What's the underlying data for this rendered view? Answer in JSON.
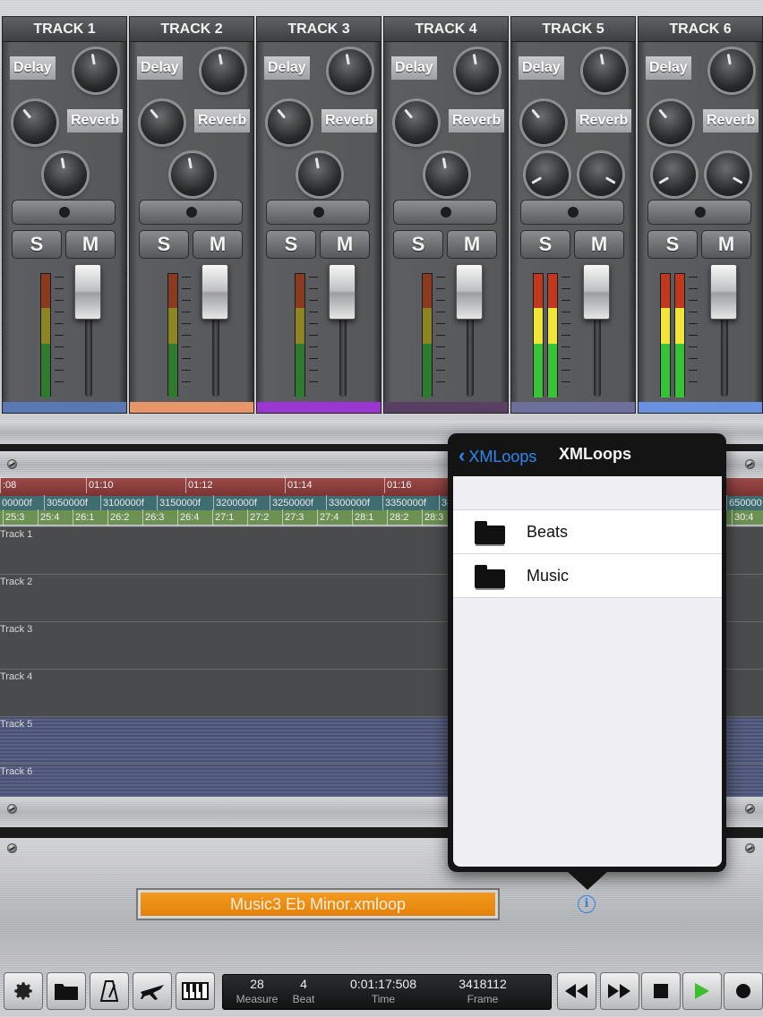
{
  "mixer": {
    "tracks": [
      {
        "title": "TRACK 1",
        "delay_label": "Delay",
        "reverb_label": "Reverb",
        "solo": "S",
        "mute": "M",
        "color": "#5a78b4"
      },
      {
        "title": "TRACK 2",
        "delay_label": "Delay",
        "reverb_label": "Reverb",
        "solo": "S",
        "mute": "M",
        "color": "#e9956a"
      },
      {
        "title": "TRACK 3",
        "delay_label": "Delay",
        "reverb_label": "Reverb",
        "solo": "S",
        "mute": "M",
        "color": "#9b37d0"
      },
      {
        "title": "TRACK 4",
        "delay_label": "Delay",
        "reverb_label": "Reverb",
        "solo": "S",
        "mute": "M",
        "color": "#5a3f64"
      },
      {
        "title": "TRACK 5",
        "delay_label": "Delay",
        "reverb_label": "Reverb",
        "solo": "S",
        "mute": "M",
        "color": "#6f6f9e"
      },
      {
        "title": "TRACK 6",
        "delay_label": "Delay",
        "reverb_label": "Reverb",
        "solo": "S",
        "mute": "M",
        "color": "#6a90e0"
      }
    ]
  },
  "timeline": {
    "time_ruler": [
      ":08",
      "01:10",
      "01:12",
      "01:14",
      "01:16"
    ],
    "frame_ruler": [
      "00000f",
      "3050000f",
      "3100000f",
      "3150000f",
      "3200000f",
      "3250000f",
      "3300000f",
      "3350000f",
      "34",
      "650000"
    ],
    "beat_ruler": [
      "25:3",
      "25:4",
      "26:1",
      "26:2",
      "26:3",
      "26:4",
      "27:1",
      "27:2",
      "27:3",
      "27:4",
      "28:1",
      "28:2",
      "28:3",
      "30:4"
    ],
    "lanes": [
      "Track 1",
      "Track 2",
      "Track 3",
      "Track 4",
      "Track 5",
      "Track 6"
    ]
  },
  "popover": {
    "back_label": "XMLoops",
    "title": "XMLoops",
    "items": [
      {
        "name": "Beats",
        "icon": "folder-icon"
      },
      {
        "name": "Music",
        "icon": "folder-icon"
      }
    ]
  },
  "bottom": {
    "file_name": "Music3 Eb Minor.xmloop",
    "info_glyph": "i",
    "toolbar_icons": [
      "gear-icon",
      "folder-icon",
      "metronome-icon",
      "airplane-icon",
      "piano-icon"
    ],
    "counter": {
      "measure": "28",
      "measure_label": "Measure",
      "beat": "4",
      "beat_label": "Beat",
      "time": "0:01:17:508",
      "time_label": "Time",
      "frame": "3418112",
      "frame_label": "Frame"
    },
    "transport_icons": [
      "rewind-icon",
      "fast-forward-icon",
      "stop-icon",
      "play-icon",
      "record-icon"
    ]
  },
  "colors": {
    "file_field": "#f39a1e",
    "link_blue": "#2f87f0",
    "play_green": "#3cbf2f"
  }
}
